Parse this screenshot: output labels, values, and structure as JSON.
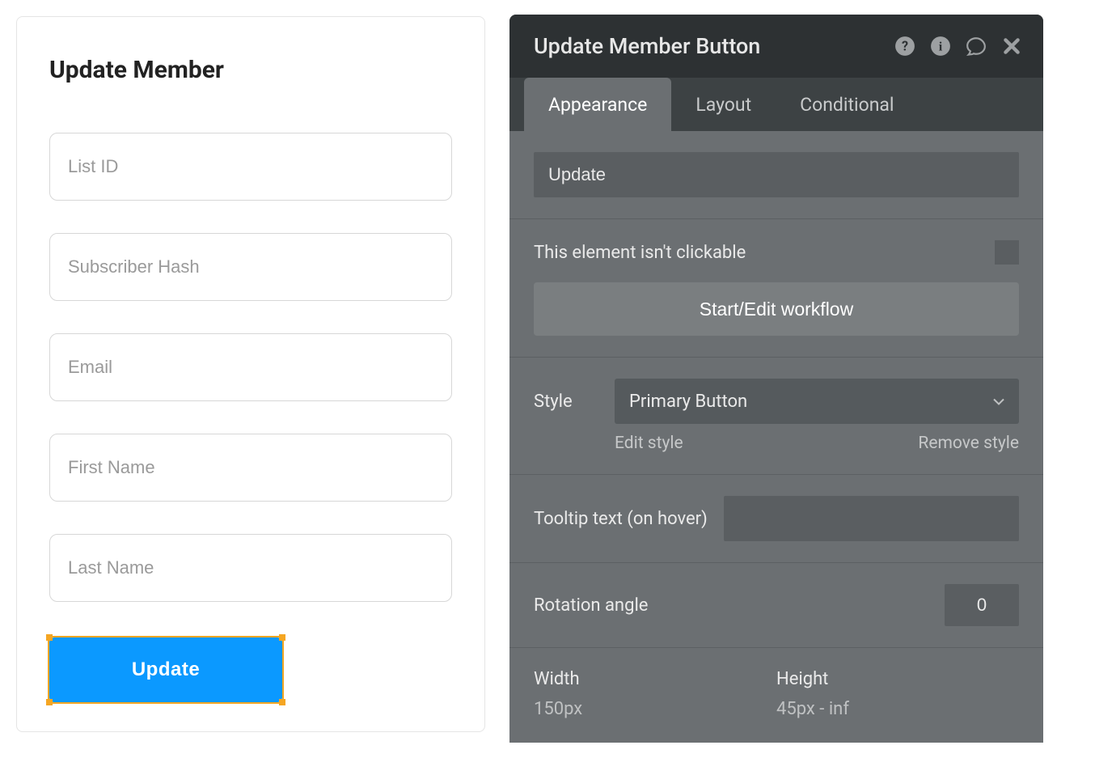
{
  "card": {
    "title": "Update Member",
    "fields": {
      "list_id": "List ID",
      "subscriber_hash": "Subscriber Hash",
      "email": "Email",
      "first_name": "First Name",
      "last_name": "Last Name"
    },
    "update_label": "Update"
  },
  "panel": {
    "title": "Update Member Button",
    "tabs": {
      "appearance": "Appearance",
      "layout": "Layout",
      "conditional": "Conditional"
    },
    "name_value": "Update",
    "clickable_label": "This element isn't clickable",
    "workflow_label": "Start/Edit workflow",
    "style": {
      "label": "Style",
      "value": "Primary Button",
      "edit": "Edit style",
      "remove": "Remove style"
    },
    "tooltip": {
      "label": "Tooltip text (on hover)",
      "value": ""
    },
    "rotation": {
      "label": "Rotation angle",
      "value": "0"
    },
    "dims": {
      "width_label": "Width",
      "width_value": "150px",
      "height_label": "Height",
      "height_value": "45px - inf"
    }
  }
}
